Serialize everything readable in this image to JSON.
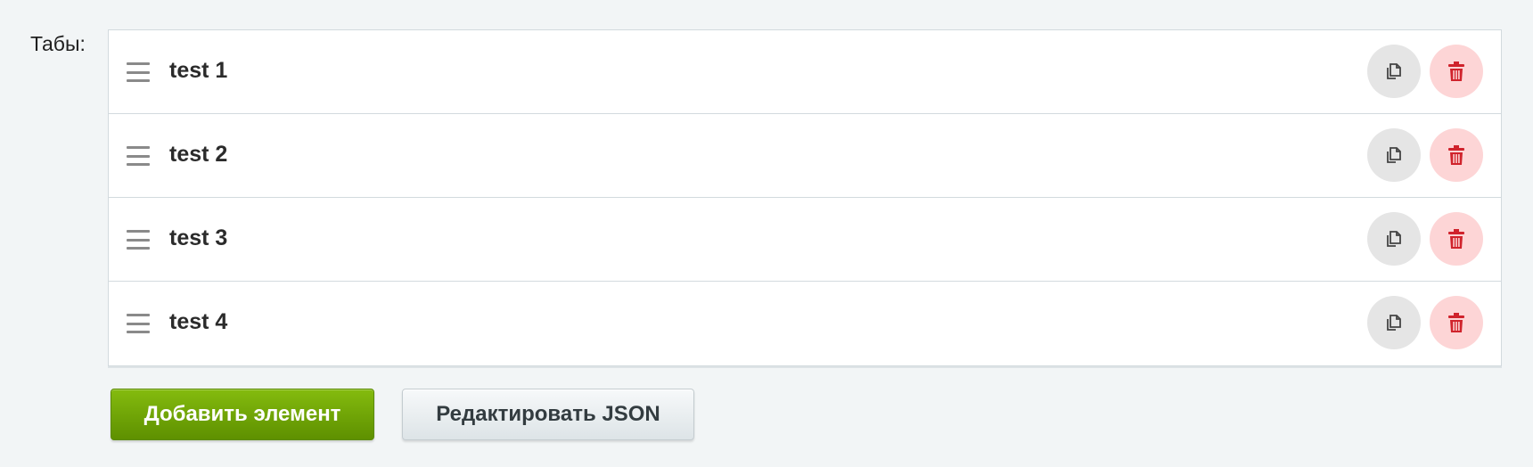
{
  "field": {
    "label": "Табы:"
  },
  "tabs": [
    {
      "title": "test 1"
    },
    {
      "title": "test 2"
    },
    {
      "title": "test 3"
    },
    {
      "title": "test 4"
    }
  ],
  "icons": {
    "drag": "drag-handle-icon",
    "copy": "copy-icon",
    "delete": "trash-icon"
  },
  "actions": {
    "add_label": "Добавить элемент",
    "edit_json_label": "Редактировать JSON"
  },
  "colors": {
    "add_button": "#6ea300",
    "delete_icon": "#d0232c",
    "delete_bg": "#fdd5d6",
    "copy_bg": "#e5e5e5",
    "background": "#f2f5f6"
  }
}
